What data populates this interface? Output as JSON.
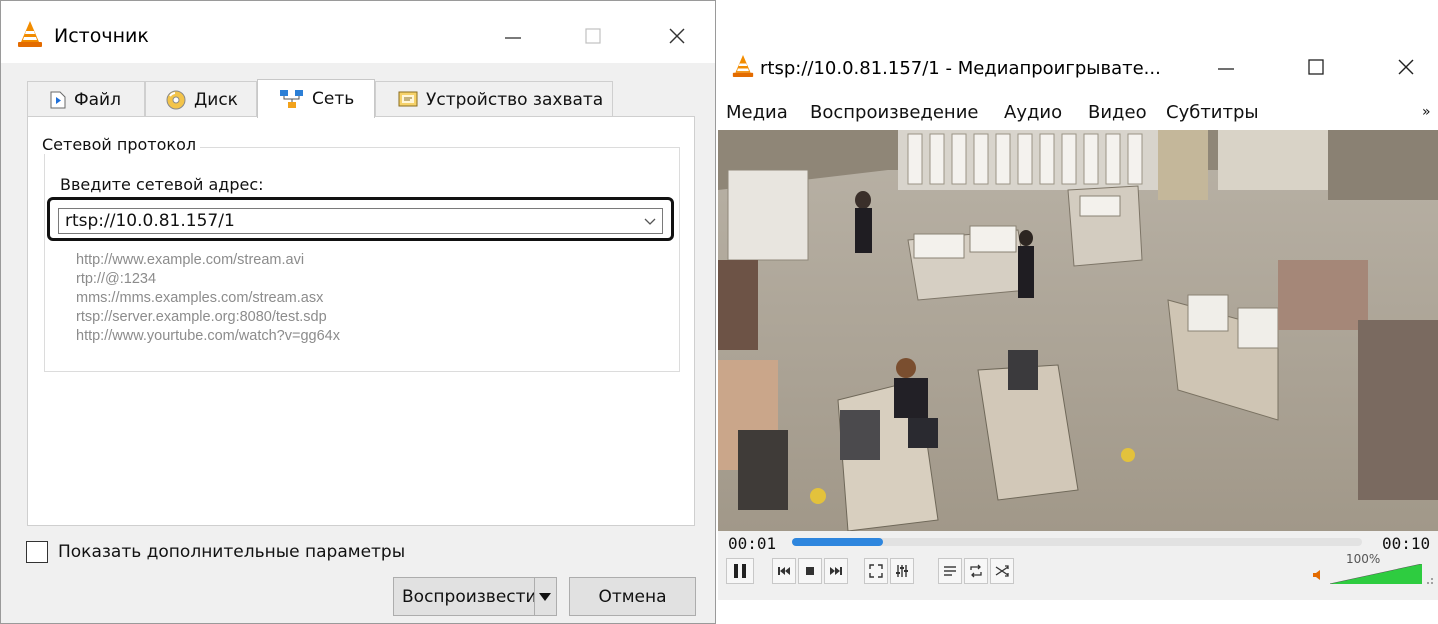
{
  "dialog": {
    "title": "Источник",
    "tabs": [
      {
        "label": "Файл",
        "icon": "file-icon"
      },
      {
        "label": "Диск",
        "icon": "disc-icon"
      },
      {
        "label": "Сеть",
        "icon": "network-icon"
      },
      {
        "label": "Устройство захвата",
        "icon": "capture-device-icon"
      }
    ],
    "active_tab": "Сеть",
    "group_title": "Сетевой протокол",
    "address_label": "Введите сетевой адрес:",
    "address_value": "rtsp://10.0.81.157/1",
    "examples": [
      "http://www.example.com/stream.avi",
      "rtp://@:1234",
      "mms://mms.examples.com/stream.asx",
      "rtsp://server.example.org:8080/test.sdp",
      "http://www.yourtube.com/watch?v=gg64x"
    ],
    "show_more_label": "Показать дополнительные параметры",
    "show_more_checked": false,
    "play_button": "Воспроизвести",
    "cancel_button": "Отмена"
  },
  "player": {
    "title": "rtsp://10.0.81.157/1 - Медиапроигрывате...",
    "menu": [
      "Медиа",
      "Воспроизведение",
      "Аудио",
      "Видео",
      "Субтитры"
    ],
    "menu_more": "»",
    "time_elapsed": "00:01",
    "time_total": "00:10",
    "progress_fraction": 0.16,
    "volume": "100%",
    "volume_fraction": 1.0,
    "colors": {
      "seek_fill": "#2e86de",
      "volume_fill": "#2ecc40",
      "vlc_cone": "#f28c00"
    }
  }
}
